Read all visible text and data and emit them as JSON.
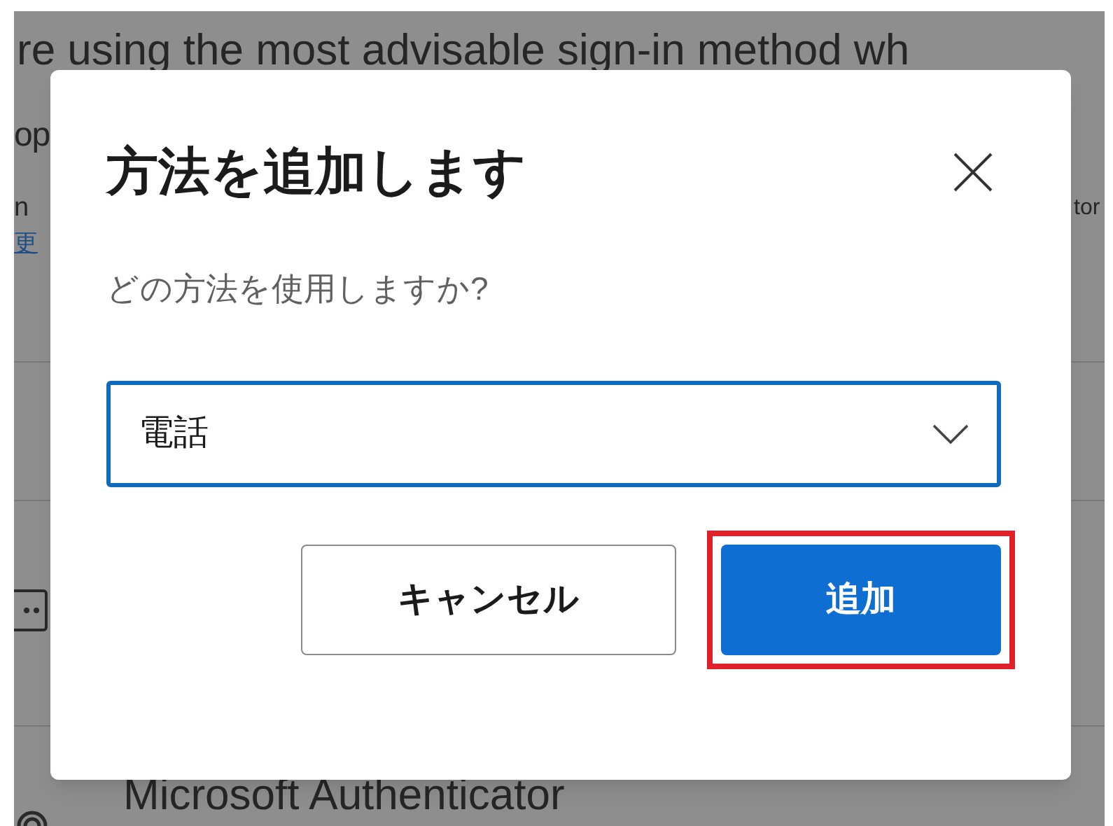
{
  "background": {
    "intro_line": "re using the most advisable sign-in method wh",
    "line_2": "op",
    "line_3_left": "n",
    "line_3_right": "tor",
    "link": "更",
    "method_name": "Microsoft Authenticator"
  },
  "dialog": {
    "title": "方法を追加します",
    "question": "どの方法を使用しますか?",
    "select": {
      "value": "電話",
      "focused": true
    },
    "buttons": [
      {
        "label": "キャンセル",
        "kind": "secondary",
        "highlighted": false
      },
      {
        "label": "追加",
        "kind": "primary",
        "highlighted": true
      }
    ]
  }
}
